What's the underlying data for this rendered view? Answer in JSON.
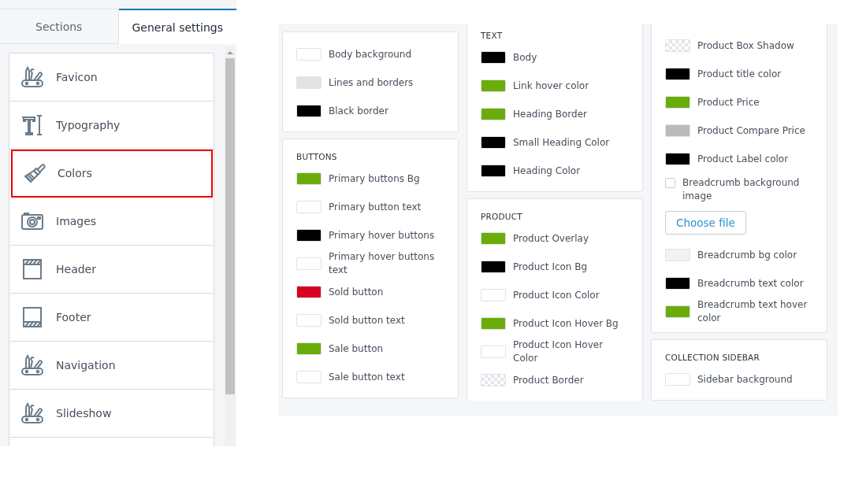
{
  "tabs": [
    {
      "label": "Sections",
      "selected": false
    },
    {
      "label": "General settings",
      "selected": true
    }
  ],
  "sidebar": {
    "items": [
      {
        "label": "Favicon",
        "kind": "tools",
        "selected": false
      },
      {
        "label": "Typography",
        "kind": "type",
        "selected": false
      },
      {
        "label": "Colors",
        "kind": "brush",
        "selected": true
      },
      {
        "label": "Images",
        "kind": "camera",
        "selected": false
      },
      {
        "label": "Header",
        "kind": "header",
        "selected": false
      },
      {
        "label": "Footer",
        "kind": "footer",
        "selected": false
      },
      {
        "label": "Navigation",
        "kind": "tools",
        "selected": false
      },
      {
        "label": "Slideshow",
        "kind": "tools",
        "selected": false
      }
    ]
  },
  "columns": [
    {
      "cards": [
        {
          "rows": [
            {
              "kind": "color",
              "label": "Body background",
              "color": "#ffffff"
            },
            {
              "kind": "color",
              "label": "Lines and borders",
              "color": "#e3e3e3"
            },
            {
              "kind": "color",
              "label": "Black border",
              "color": "#000000"
            }
          ]
        },
        {
          "heading": "BUTTONS",
          "rows": [
            {
              "kind": "color",
              "label": "Primary buttons Bg",
              "color": "#6aad0a"
            },
            {
              "kind": "color",
              "label": "Primary button text",
              "color": "#ffffff"
            },
            {
              "kind": "color",
              "label": "Primary hover buttons",
              "color": "#000000"
            },
            {
              "kind": "color",
              "label": "Primary hover buttons text",
              "color": "#ffffff"
            },
            {
              "kind": "color",
              "label": "Sold button",
              "color": "#d9001f"
            },
            {
              "kind": "color",
              "label": "Sold button text",
              "color": "#ffffff"
            },
            {
              "kind": "color",
              "label": "Sale button",
              "color": "#6aad0a"
            },
            {
              "kind": "color",
              "label": "Sale button text",
              "color": "#ffffff"
            }
          ]
        }
      ]
    },
    {
      "cards": [
        {
          "heading": "TEXT",
          "rows": [
            {
              "kind": "color",
              "label": "Body",
              "color": "#000000"
            },
            {
              "kind": "color",
              "label": "Link hover color",
              "color": "#6aad0a"
            },
            {
              "kind": "color",
              "label": "Heading Border",
              "color": "#6aad0a"
            },
            {
              "kind": "color",
              "label": "Small Heading Color",
              "color": "#000000"
            },
            {
              "kind": "color",
              "label": "Heading Color",
              "color": "#000000"
            }
          ]
        },
        {
          "heading": "PRODUCT",
          "rows": [
            {
              "kind": "color",
              "label": "Product Overlay",
              "color": "#6aad0a"
            },
            {
              "kind": "color",
              "label": "Product Icon Bg",
              "color": "#000000"
            },
            {
              "kind": "color",
              "label": "Product Icon Color",
              "color": "#ffffff"
            },
            {
              "kind": "color",
              "label": "Product Icon Hover Bg",
              "color": "#6aad0a"
            },
            {
              "kind": "color",
              "label": "Product Icon Hover Color",
              "color": "#ffffff"
            },
            {
              "kind": "transparent",
              "label": "Product Border"
            }
          ]
        }
      ]
    },
    {
      "cards": [
        {
          "rows": [
            {
              "kind": "transparent",
              "label": "Product Box Shadow"
            },
            {
              "kind": "color",
              "label": "Product title color",
              "color": "#000000"
            },
            {
              "kind": "color",
              "label": "Product Price",
              "color": "#6aad0a"
            },
            {
              "kind": "color",
              "label": "Product Compare Price",
              "color": "#bababa"
            },
            {
              "kind": "color",
              "label": "Product Label color",
              "color": "#000000"
            },
            {
              "kind": "checkbox",
              "label": "Breadcrumb background image",
              "checked": false
            },
            {
              "kind": "file",
              "label": "Choose file"
            },
            {
              "kind": "color",
              "label": "Breadcrumb bg color",
              "color": "#f2f2f2"
            },
            {
              "kind": "color",
              "label": "Breadcrumb text color",
              "color": "#000000"
            },
            {
              "kind": "color",
              "label": "Breadcrumb text hover color",
              "color": "#6aad0a"
            }
          ]
        },
        {
          "heading": "COLLECTION SIDEBAR",
          "rows": [
            {
              "kind": "color",
              "label": "Sidebar background",
              "color": "#ffffff"
            }
          ]
        }
      ]
    }
  ]
}
